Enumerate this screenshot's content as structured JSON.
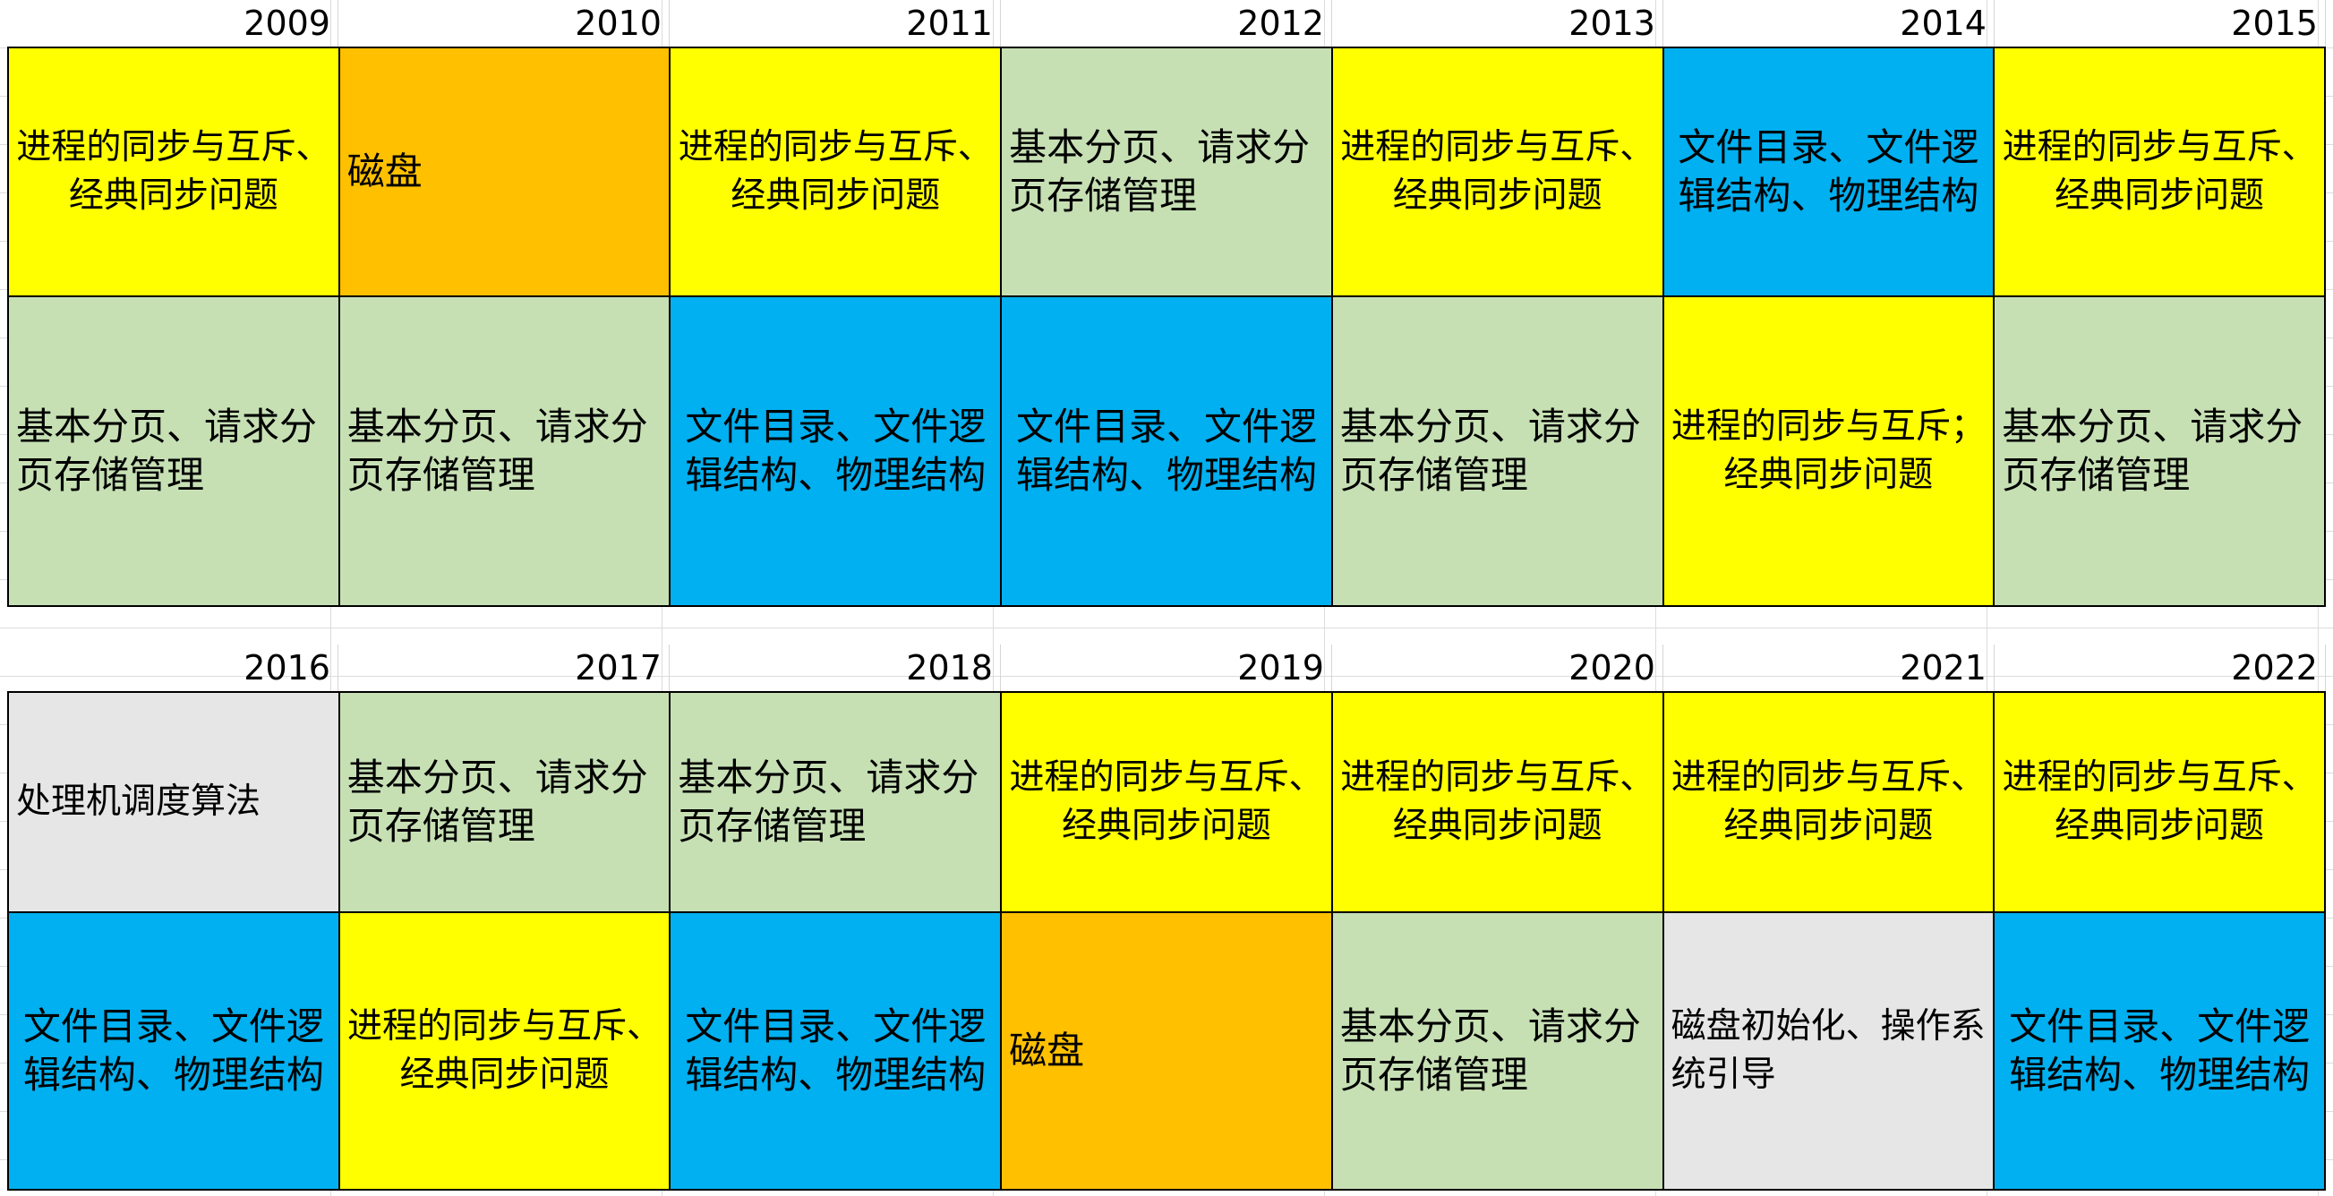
{
  "colors": {
    "yellow": "#FFFF00",
    "orange": "#FFC000",
    "green": "#C6E0B4",
    "blue": "#00B0F0",
    "gray": "#E7E6E6"
  },
  "block1": {
    "years": [
      "2009",
      "2010",
      "2011",
      "2012",
      "2013",
      "2014",
      "2015"
    ],
    "rows": [
      [
        {
          "text": "进程的同步与互斥、经典同步问题",
          "color": "#FFFF00",
          "align": "center",
          "size": "small"
        },
        {
          "text": "磁盘",
          "color": "#FFC000",
          "align": "left"
        },
        {
          "text": "进程的同步与互斥、经典同步问题",
          "color": "#FFFF00",
          "align": "center",
          "size": "small"
        },
        {
          "text": "基本分页、请求分页存储管理",
          "color": "#C6E0B4",
          "align": "left"
        },
        {
          "text": "进程的同步与互斥、经典同步问题",
          "color": "#FFFF00",
          "align": "center",
          "size": "small"
        },
        {
          "text": "文件目录、文件逻辑结构、物理结构",
          "color": "#00B0F0",
          "align": "center"
        },
        {
          "text": "进程的同步与互斥、经典同步问题",
          "color": "#FFFF00",
          "align": "center",
          "size": "small"
        }
      ],
      [
        {
          "text": "基本分页、请求分页存储管理",
          "color": "#C6E0B4",
          "align": "left"
        },
        {
          "text": "基本分页、请求分页存储管理",
          "color": "#C6E0B4",
          "align": "left"
        },
        {
          "text": "文件目录、文件逻辑结构、物理结构",
          "color": "#00B0F0",
          "align": "center"
        },
        {
          "text": "文件目录、文件逻辑结构、物理结构",
          "color": "#00B0F0",
          "align": "center"
        },
        {
          "text": "基本分页、请求分页存储管理",
          "color": "#C6E0B4",
          "align": "left"
        },
        {
          "text": "进程的同步与互斥；经典同步问题",
          "color": "#FFFF00",
          "align": "center",
          "size": "small"
        },
        {
          "text": "基本分页、请求分页存储管理",
          "color": "#C6E0B4",
          "align": "left"
        }
      ]
    ]
  },
  "block2": {
    "years": [
      "2016",
      "2017",
      "2018",
      "2019",
      "2020",
      "2021",
      "2022"
    ],
    "rows": [
      [
        {
          "text": "处理机调度算法",
          "color": "#E7E6E6",
          "align": "left",
          "size": "small"
        },
        {
          "text": "基本分页、请求分页存储管理",
          "color": "#C6E0B4",
          "align": "left"
        },
        {
          "text": "基本分页、请求分页存储管理",
          "color": "#C6E0B4",
          "align": "left"
        },
        {
          "text": "进程的同步与互斥、经典同步问题",
          "color": "#FFFF00",
          "align": "center",
          "size": "small"
        },
        {
          "text": "进程的同步与互斥、经典同步问题",
          "color": "#FFFF00",
          "align": "center",
          "size": "small"
        },
        {
          "text": "进程的同步与互斥、经典同步问题",
          "color": "#FFFF00",
          "align": "center",
          "size": "small"
        },
        {
          "text": "进程的同步与互斥、经典同步问题",
          "color": "#FFFF00",
          "align": "center",
          "size": "small"
        }
      ],
      [
        {
          "text": "文件目录、文件逻辑结构、物理结构",
          "color": "#00B0F0",
          "align": "center"
        },
        {
          "text": "进程的同步与互斥、经典同步问题",
          "color": "#FFFF00",
          "align": "center",
          "size": "small"
        },
        {
          "text": "文件目录、文件逻辑结构、物理结构",
          "color": "#00B0F0",
          "align": "center"
        },
        {
          "text": "磁盘",
          "color": "#FFC000",
          "align": "left"
        },
        {
          "text": "基本分页、请求分页存储管理",
          "color": "#C6E0B4",
          "align": "left"
        },
        {
          "text": "磁盘初始化、操作系统引导",
          "color": "#E7E6E6",
          "align": "left",
          "size": "small"
        },
        {
          "text": "文件目录、文件逻辑结构、物理结构",
          "color": "#00B0F0",
          "align": "center"
        }
      ]
    ]
  }
}
